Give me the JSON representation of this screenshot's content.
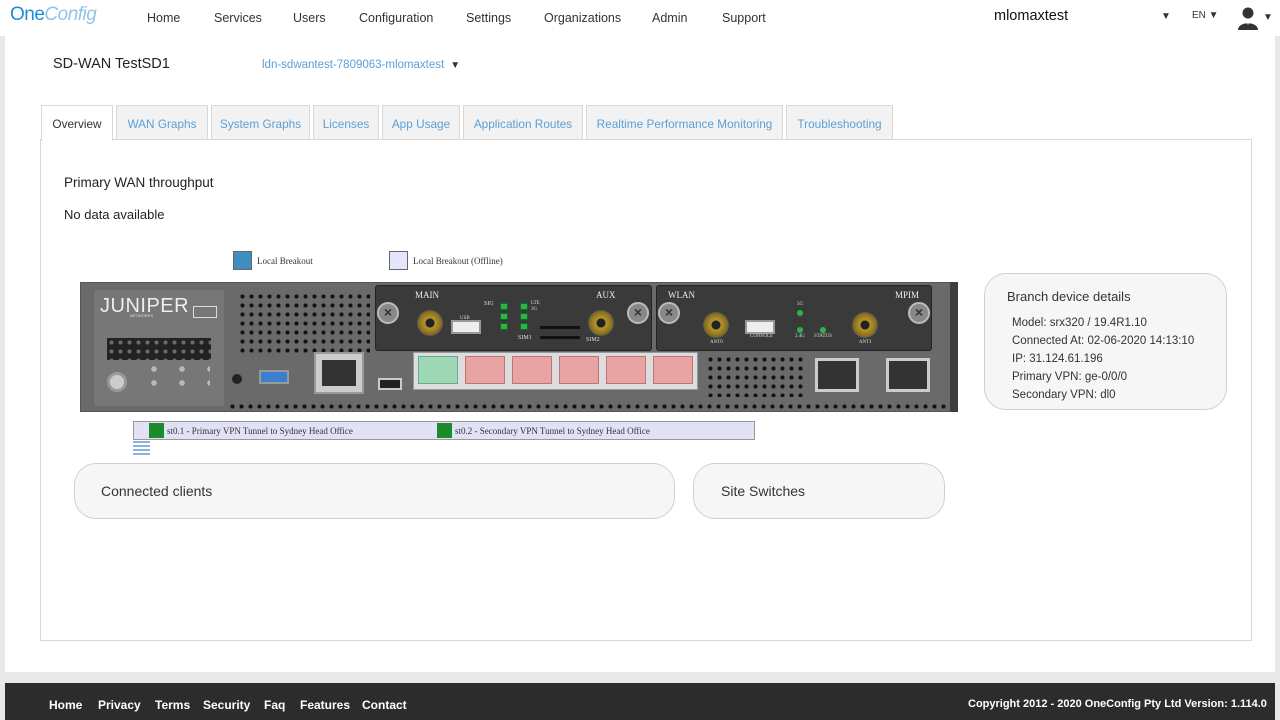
{
  "brand": {
    "name_main": "One",
    "name_light": "Config"
  },
  "nav": {
    "items": [
      "Home",
      "Services",
      "Users",
      "Configuration",
      "Settings",
      "Organizations",
      "Admin",
      "Support"
    ],
    "user_name": "mlomaxtest",
    "language": "EN",
    "icons": {
      "user": "user-icon",
      "caret": "chevron-down-icon"
    }
  },
  "page": {
    "title": "SD-WAN TestSD1",
    "device_select": "ldn-sdwantest-7809063-mlomaxtest"
  },
  "tabs": [
    {
      "label": "Overview",
      "active": true
    },
    {
      "label": "WAN Graphs"
    },
    {
      "label": "System Graphs"
    },
    {
      "label": "Licenses"
    },
    {
      "label": "App Usage"
    },
    {
      "label": "Application Routes"
    },
    {
      "label": "Realtime Performance Monitoring"
    },
    {
      "label": "Troubleshooting"
    }
  ],
  "overview": {
    "wan_title": "Primary WAN throughput",
    "no_data": "No data available",
    "legend": [
      {
        "label": "Local Breakout",
        "color": "#3e8fbf"
      },
      {
        "label": "Local Breakout (Offline)",
        "color": "#e6e6fa"
      }
    ],
    "device_image": {
      "brand": "JUNIPER",
      "brand_sub": "NETWORKS",
      "modules": {
        "main": "MAIN",
        "aux": "AUX",
        "wlan": "WLAN",
        "mpim": "MPIM",
        "sig": "SIG",
        "sim1": "SIM1",
        "sim2": "SIM2",
        "usb": "USB",
        "ant0": "ANT0",
        "ant1": "ANT1",
        "console": "CONSOLE",
        "g24": "2.4G",
        "g5": "5G",
        "status": "STATUS",
        "lte_a": "LTE",
        "lte_b": "3G"
      }
    },
    "tunnels": [
      {
        "label": "st0.1 - Primary VPN Tunnel to Sydney Head Office",
        "color": "#1d8a2c"
      },
      {
        "label": "st0.2 - Secondary VPN Tunnel to Sydney Head Office",
        "color": "#1d8a2c"
      }
    ],
    "branch_details": {
      "title": "Branch device details",
      "model": "Model: srx320 / 19.4R1.10",
      "connected": "Connected At: 02-06-2020 14:13:10",
      "ip": "IP: 31.124.61.196",
      "primary_vpn": "Primary VPN: ge-0/0/0",
      "secondary_vpn": "Secondary VPN: dl0"
    },
    "connected_clients_title": "Connected clients",
    "site_switches_title": "Site Switches"
  },
  "footer": {
    "links": [
      "Home",
      "Privacy",
      "Terms",
      "Security",
      "Faq",
      "Features",
      "Contact"
    ],
    "copyright": "Copyright 2012 - 2020 OneConfig Pty Ltd Version: 1.114.0"
  }
}
